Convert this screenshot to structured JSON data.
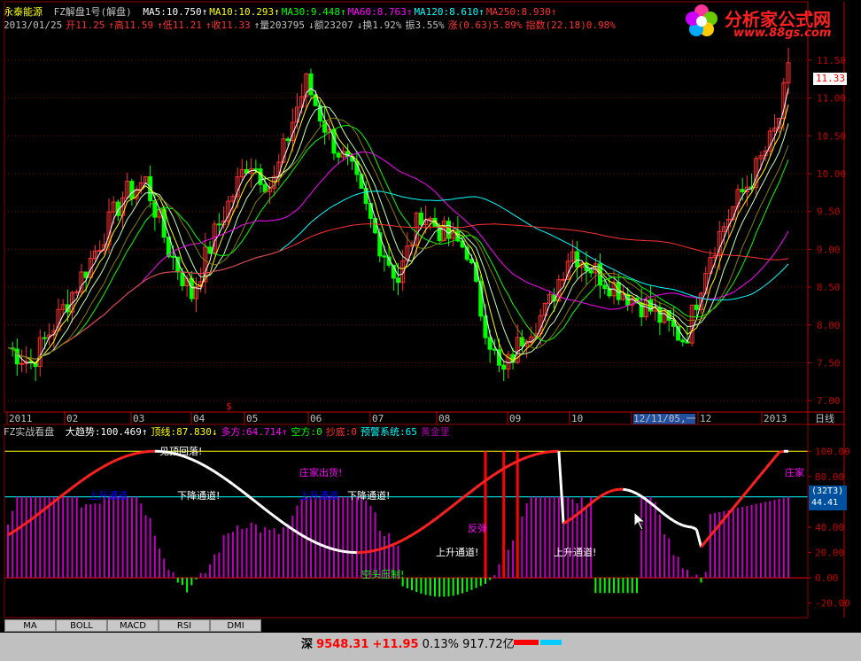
{
  "header": {
    "stock_name": "永泰能源",
    "indicator": "FZ解盘1号(解盘)",
    "ma": [
      {
        "label": "MA5:10.750",
        "color": "#ffffff",
        "arrow": "↑"
      },
      {
        "label": "MA10:10.293",
        "color": "#ffff00",
        "arrow": "↑"
      },
      {
        "label": "MA30:9.448",
        "color": "#00ff00",
        "arrow": "↑"
      },
      {
        "label": "MA60:8.763",
        "color": "#ff00ff",
        "arrow": "↑"
      },
      {
        "label": "MA120:8.610",
        "color": "#00ffff",
        "arrow": "↑"
      },
      {
        "label": "MA250:8.930",
        "color": "#ff3030",
        "arrow": "↑"
      }
    ],
    "line2": [
      {
        "label": "2013/01/25",
        "color": "#c0c0c0"
      },
      {
        "label": "开11.25",
        "color": "#ff3030"
      },
      {
        "label": "↑高11.59",
        "color": "#ff3030"
      },
      {
        "label": "↑低11.21",
        "color": "#ff3030"
      },
      {
        "label": "↑收11.33",
        "color": "#ff3030"
      },
      {
        "label": "↑量203795",
        "color": "#c0c0c0"
      },
      {
        "label": "↓额23207",
        "color": "#c0c0c0"
      },
      {
        "label": "↓换1.92%",
        "color": "#c0c0c0"
      },
      {
        "label": "振3.55%",
        "color": "#c0c0c0"
      },
      {
        "label": "涨(0.63)5.89%",
        "color": "#ff3030"
      },
      {
        "label": "指数(22.18)0.98%",
        "color": "#ff3030"
      }
    ]
  },
  "logo": {
    "title": "分析家公式网",
    "url": "www.88gs.com"
  },
  "price_axis": {
    "ticks": [
      "11.50",
      "11.00",
      "10.50",
      "10.00",
      "9.50",
      "9.00",
      "8.50",
      "8.00",
      "7.50",
      "7.00"
    ],
    "current": "11.33",
    "ylim": [
      6.85,
      11.85
    ]
  },
  "time_axis": {
    "labels": [
      "2011",
      "02",
      "03",
      "04",
      "05",
      "06",
      "07",
      "08",
      "09",
      "10",
      "12/11/05,一",
      "12",
      "2013"
    ],
    "right_label": "日线"
  },
  "indicator_panel": {
    "title": "FZ实战看盘",
    "values": [
      {
        "label": "大趋势:100.469",
        "color": "#ffffff",
        "arrow": "↑"
      },
      {
        "label": "顶线:87.830",
        "color": "#ffff00",
        "arrow": "↓"
      },
      {
        "label": "多方:64.714",
        "color": "#ff00ff",
        "arrow": "↑"
      },
      {
        "label": "空方:0",
        "color": "#00ff00",
        "arrow": ""
      },
      {
        "label": "抄底:0",
        "color": "#ff3030",
        "arrow": ""
      },
      {
        "label": "预警系统:65",
        "color": "#00ffff",
        "arrow": ""
      },
      {
        "label": "黄金里",
        "color": "#a000a0",
        "arrow": ""
      }
    ],
    "ticks": [
      "100.00",
      "80.00",
      "60.00",
      "40.00",
      "20.00",
      "0.00",
      "-20.00"
    ],
    "ylim": [
      -30,
      110
    ],
    "readout": [
      "(32T3)",
      "44.41"
    ],
    "annotations": [
      {
        "text": "见顶回落!",
        "color": "#ffffff",
        "x": 180,
        "y": 513
      },
      {
        "text": "庄家出货!",
        "color": "#ff00ff",
        "x": 338,
        "y": 537
      },
      {
        "text": "上升通道",
        "color": "#0000ff",
        "x": 100,
        "y": 563
      },
      {
        "text": "下降通道!",
        "color": "#ffffff",
        "x": 200,
        "y": 563
      },
      {
        "text": "上升通道",
        "color": "#0000ff",
        "x": 338,
        "y": 563
      },
      {
        "text": "下降通道!",
        "color": "#ffffff",
        "x": 392,
        "y": 563
      },
      {
        "text": "上升通道!",
        "color": "#ffffff",
        "x": 492,
        "y": 627
      },
      {
        "text": "上升通道!",
        "color": "#ffffff",
        "x": 625,
        "y": 627
      },
      {
        "text": "反弹",
        "color": "#ff00ff",
        "x": 528,
        "y": 600
      },
      {
        "text": "空头压制!",
        "color": "#00ff00",
        "x": 408,
        "y": 652
      },
      {
        "text": "庄家",
        "color": "#ff00ff",
        "x": 886,
        "y": 537
      }
    ]
  },
  "tabs": [
    "MA",
    "BOLL",
    "MACD",
    "RSI",
    "DMI"
  ],
  "status": {
    "index_name": "深",
    "index_value": "9548.31",
    "change": "+11.95",
    "pct": "0.13%",
    "amount": "917.72亿"
  },
  "colors": {
    "up": "#ff3030",
    "down": "#00ff00",
    "grid": "#8b0000"
  }
}
